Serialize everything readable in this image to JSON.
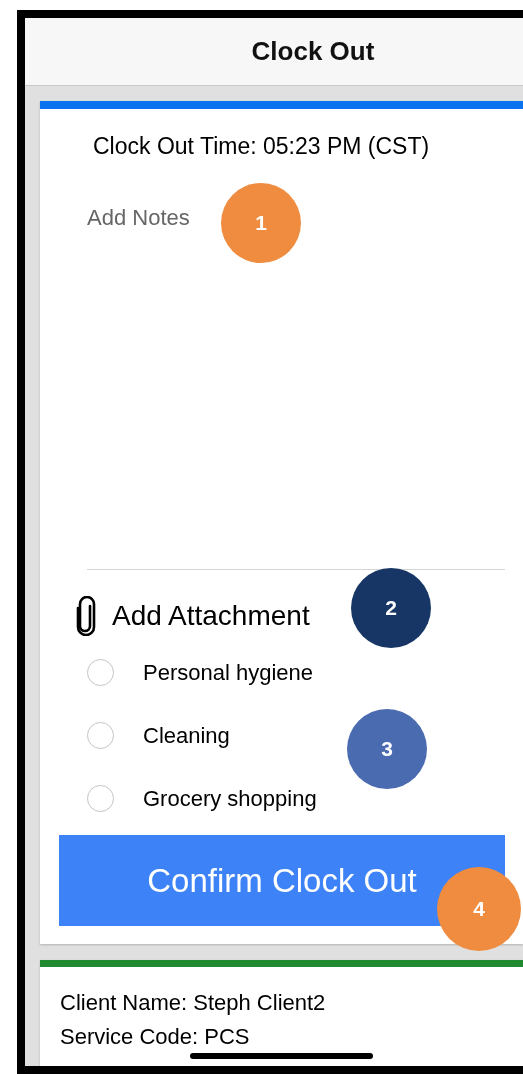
{
  "header": {
    "title": "Clock Out"
  },
  "clock_out_card": {
    "time_label": "Clock Out Time: 05:23 PM (CST)",
    "notes": {
      "placeholder": "Add Notes"
    },
    "attachment": {
      "label": "Add Attachment"
    },
    "tasks": [
      {
        "label": "Personal hygiene",
        "selected": false
      },
      {
        "label": "Cleaning",
        "selected": false
      },
      {
        "label": "Grocery shopping",
        "selected": false
      }
    ],
    "confirm_button": "Confirm Clock Out"
  },
  "client_card": {
    "lines": [
      "Client Name: Steph Client2",
      "Service Code: PCS"
    ]
  },
  "callouts": [
    {
      "number": "1",
      "color": "#ef8c3f"
    },
    {
      "number": "2",
      "color": "#173665"
    },
    {
      "number": "3",
      "color": "#4a6bb0"
    },
    {
      "number": "4",
      "color": "#ef8c3f"
    }
  ]
}
